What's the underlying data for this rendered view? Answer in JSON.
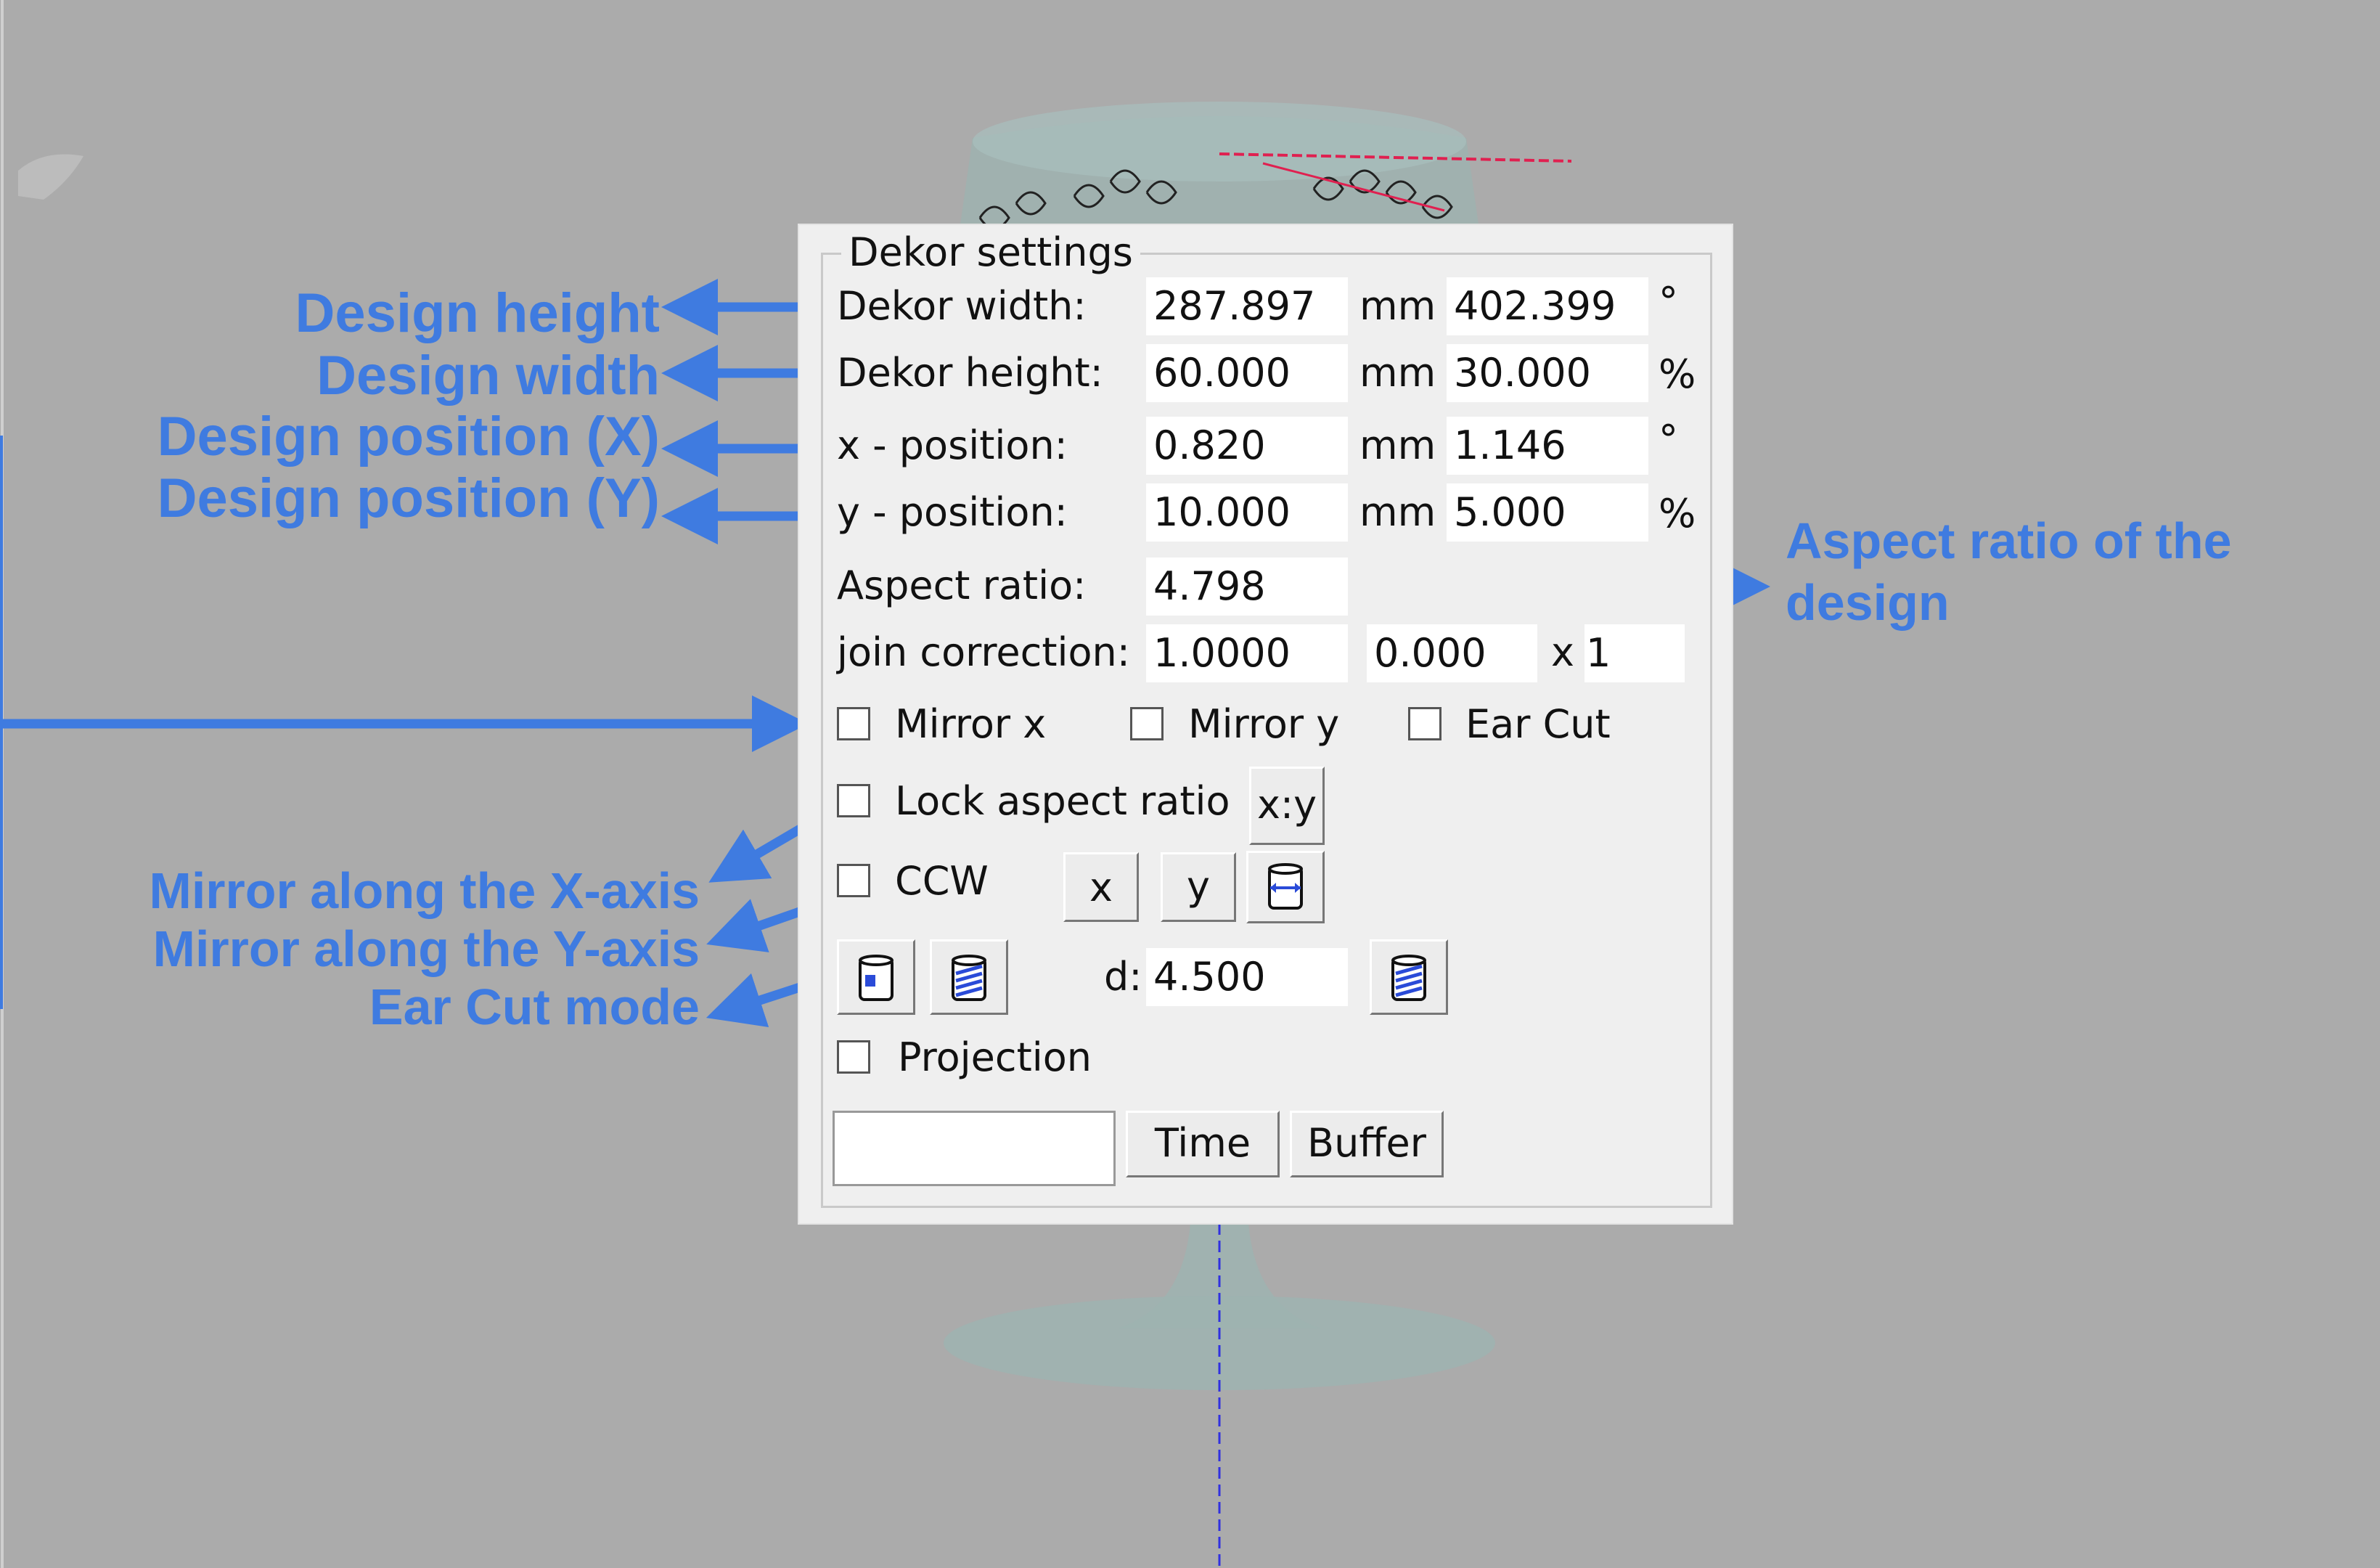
{
  "panel": {
    "title": "Dekor settings",
    "rows": {
      "width": {
        "label": "Dekor width:",
        "value": "287.897",
        "unit1": "mm",
        "value2": "402.399",
        "unit2": "°"
      },
      "height": {
        "label": "Dekor height:",
        "value": "60.000",
        "unit1": "mm",
        "value2": "30.000",
        "unit2": "%"
      },
      "xpos": {
        "label": "x - position:",
        "value": "0.820",
        "unit1": "mm",
        "value2": "1.146",
        "unit2": "°"
      },
      "ypos": {
        "label": "y - position:",
        "value": "10.000",
        "unit1": "mm",
        "value2": "5.000",
        "unit2": "%"
      },
      "aspect": {
        "label": "Aspect ratio:",
        "value": "4.798"
      },
      "join": {
        "label": "join correction:",
        "value": "1.0000",
        "value2": "0.000",
        "x_label": "x",
        "value3": "1"
      }
    },
    "checkboxes": {
      "mirror_x": "Mirror x",
      "mirror_y": "Mirror y",
      "ear_cut": "Ear Cut",
      "lock_aspect": "Lock aspect ratio",
      "ccw": "CCW",
      "projection": "Projection"
    },
    "buttons": {
      "xy": "x:y",
      "x": "x",
      "y": "y",
      "time": "Time",
      "buffer": "Buffer"
    },
    "d_label": "d:",
    "d_value": "4.500",
    "text_input_value": ""
  },
  "annotations": {
    "design_height": "Design height",
    "design_width": "Design width",
    "design_pos_x": "Design position (X)",
    "design_pos_y": "Design position (Y)",
    "aspect_line1": "Aspect ratio of the",
    "aspect_line2": "design",
    "mirror_x_axis": "Mirror along the X-axis",
    "mirror_y_axis": "Mirror along the Y-axis",
    "ear_cut_mode": "Ear Cut mode"
  },
  "colors": {
    "annotation": "#3f7be0",
    "background": "#ababab",
    "panel": "#efefef"
  }
}
